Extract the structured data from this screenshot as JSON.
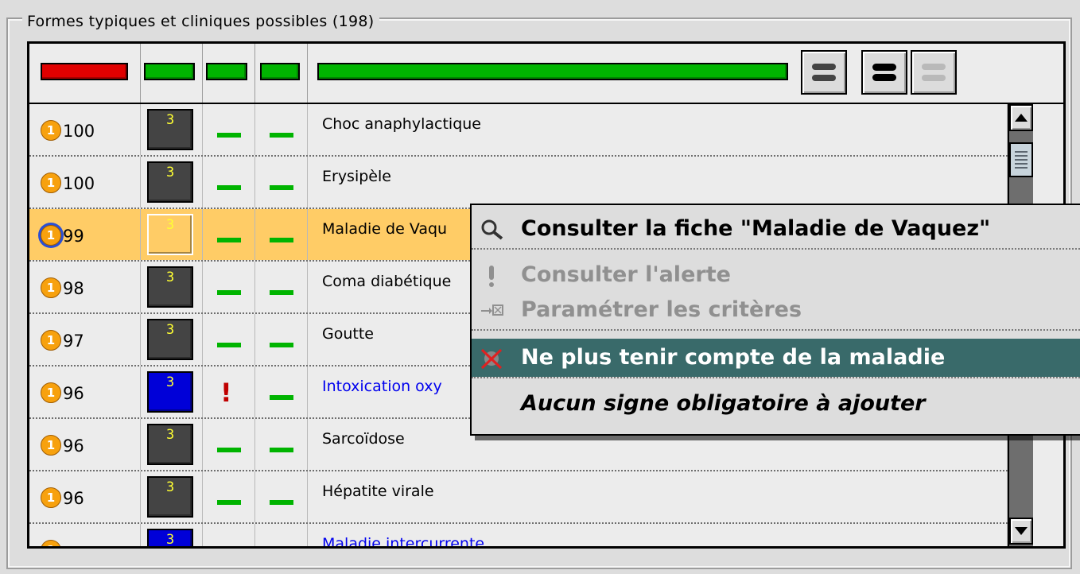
{
  "group": {
    "title": "Formes typiques et cliniques possibles (198)"
  },
  "header": {
    "bar_colors": [
      "#e00000",
      "#00b400",
      "#00b400",
      "#00b400",
      "#00b400"
    ],
    "buttons": [
      {
        "name": "view-lines-button",
        "state": "pressed"
      },
      {
        "name": "view-bold-lines-button",
        "state": "normal"
      },
      {
        "name": "view-light-lines-button",
        "state": "disabled"
      }
    ]
  },
  "rows": [
    {
      "score": "100",
      "badge": "3",
      "badge_color": "#444444",
      "alert": "dash",
      "extra": "dash",
      "name": "Choc anaphylactique",
      "name_color": "#000000"
    },
    {
      "score": "100",
      "badge": "3",
      "badge_color": "#444444",
      "alert": "dash",
      "extra": "dash",
      "name": "Erysipèle",
      "name_color": "#000000"
    },
    {
      "score": "99",
      "badge": "3",
      "badge_color": "#ffcc66",
      "alert": "dash",
      "extra": "dash",
      "name": "Maladie de Vaqu",
      "name_color": "#000000",
      "selected": true
    },
    {
      "score": "98",
      "badge": "3",
      "badge_color": "#444444",
      "alert": "dash",
      "extra": "dash",
      "name": "Coma diabétique",
      "name_color": "#000000"
    },
    {
      "score": "97",
      "badge": "3",
      "badge_color": "#444444",
      "alert": "dash",
      "extra": "dash",
      "name": "Goutte",
      "name_color": "#000000"
    },
    {
      "score": "96",
      "badge": "3",
      "badge_color": "#0000d8",
      "alert": "exclam",
      "extra": "dash",
      "name": "Intoxication oxy",
      "name_color": "#0000ee"
    },
    {
      "score": "96",
      "badge": "3",
      "badge_color": "#444444",
      "alert": "dash",
      "extra": "dash",
      "name": "Sarcoïdose",
      "name_color": "#000000"
    },
    {
      "score": "96",
      "badge": "3",
      "badge_color": "#444444",
      "alert": "dash",
      "extra": "dash",
      "name": "Hépatite virale",
      "name_color": "#000000"
    },
    {
      "score": "",
      "badge": "3",
      "badge_color": "#0000d8",
      "alert": "dash",
      "extra": "dash",
      "name": "Maladie intercurrente",
      "name_color": "#0000ee"
    }
  ],
  "coin_label": "1",
  "context_menu": {
    "items": [
      {
        "label": "Consulter la fiche \"Maladie de Vaquez\"",
        "icon": "magnifier-icon",
        "state": "enabled"
      },
      {
        "label": "Consulter l'alerte",
        "icon": "exclamation-icon",
        "state": "disabled"
      },
      {
        "label": "Paramétrer les critères",
        "icon": "criteria-arrow-icon",
        "state": "disabled"
      },
      {
        "label": "Ne plus tenir compte de la maladie",
        "icon": "strike-icon",
        "state": "highlighted"
      },
      {
        "label": "Aucun signe obligatoire à ajouter",
        "icon": "",
        "state": "italic"
      }
    ]
  }
}
